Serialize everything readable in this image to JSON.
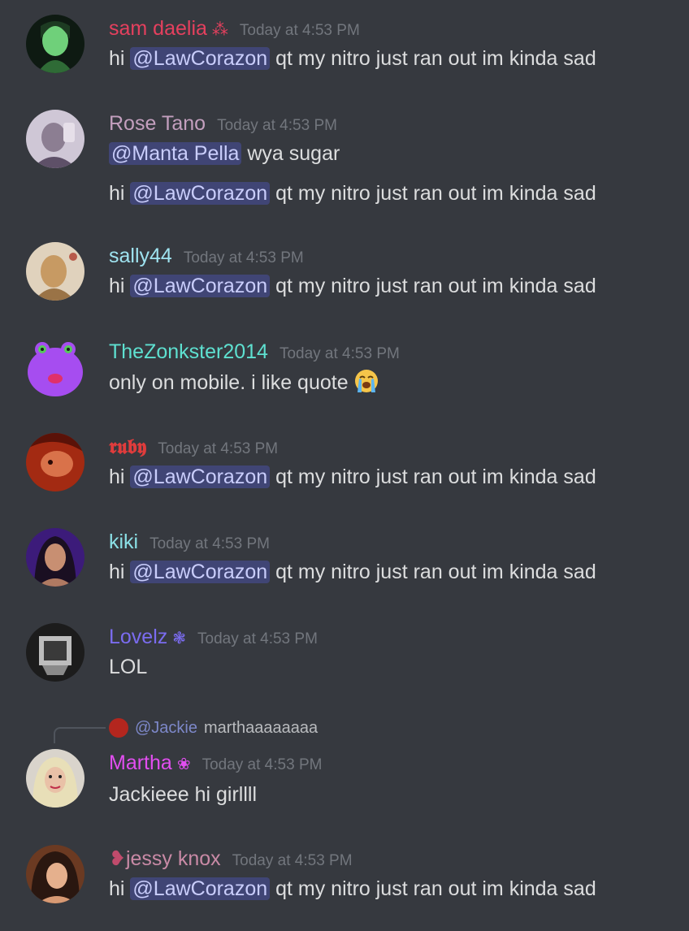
{
  "messages": [
    {
      "username": "sam daelia",
      "username_color": "#e5405e",
      "badge": "⁂",
      "timestamp": "Today at 4:53 PM",
      "lines": [
        {
          "pre": "hi ",
          "mention": "@LawCorazon",
          "post": " qt my nitro just ran out im kinda sad"
        }
      ]
    },
    {
      "username": "Rose Tano",
      "username_color": "#c39fbe",
      "timestamp": "Today at 4:53 PM",
      "lines": [
        {
          "pre": "",
          "mention": "@Manta Pella",
          "post": " wya sugar"
        },
        {
          "pre": "hi ",
          "mention": "@LawCorazon",
          "post": " qt my nitro just ran out im kinda sad"
        }
      ]
    },
    {
      "username": "sally44",
      "username_color": "#9fe3f0",
      "timestamp": "Today at 4:53 PM",
      "lines": [
        {
          "pre": "hi ",
          "mention": "@LawCorazon",
          "post": " qt my nitro just ran out im kinda sad"
        }
      ]
    },
    {
      "username": "TheZonkster2014",
      "username_color": "#5ee0d0",
      "timestamp": "Today at 4:53 PM",
      "lines": [
        {
          "text": "only on mobile. i like quote",
          "emoji": "loudly-crying-face"
        }
      ]
    },
    {
      "username": "𝖗𝖚𝖇𝖞",
      "username_color": "#e03c3c",
      "timestamp": "Today at 4:53 PM",
      "lines": [
        {
          "pre": "hi ",
          "mention": "@LawCorazon",
          "post": " qt my nitro just ran out im kinda sad"
        }
      ]
    },
    {
      "username": "kiki",
      "username_color": "#8be0e6",
      "timestamp": "Today at 4:53 PM",
      "lines": [
        {
          "pre": "hi ",
          "mention": "@LawCorazon",
          "post": " qt my nitro just ran out im kinda sad"
        }
      ]
    },
    {
      "username": "Lovelz",
      "username_color": "#7b6cf0",
      "badge": "❃",
      "timestamp": "Today at 4:53 PM",
      "lines": [
        {
          "text": "LOL"
        }
      ]
    },
    {
      "reply": {
        "mention": "@Jackie",
        "text": "marthaaaaaaaa"
      },
      "username": "Martha",
      "username_color": "#e24ef0",
      "badge": "❀",
      "timestamp": "Today at 4:53 PM",
      "lines": [
        {
          "text": "Jackieee hi girllll"
        }
      ]
    },
    {
      "username_prefix": "❥",
      "username": "jessy knox",
      "username_color": "#c98aa6",
      "timestamp": "Today at 4:53 PM",
      "lines": [
        {
          "pre": "hi ",
          "mention": "@LawCorazon",
          "post": " qt my nitro just ran out im kinda sad"
        }
      ]
    }
  ]
}
